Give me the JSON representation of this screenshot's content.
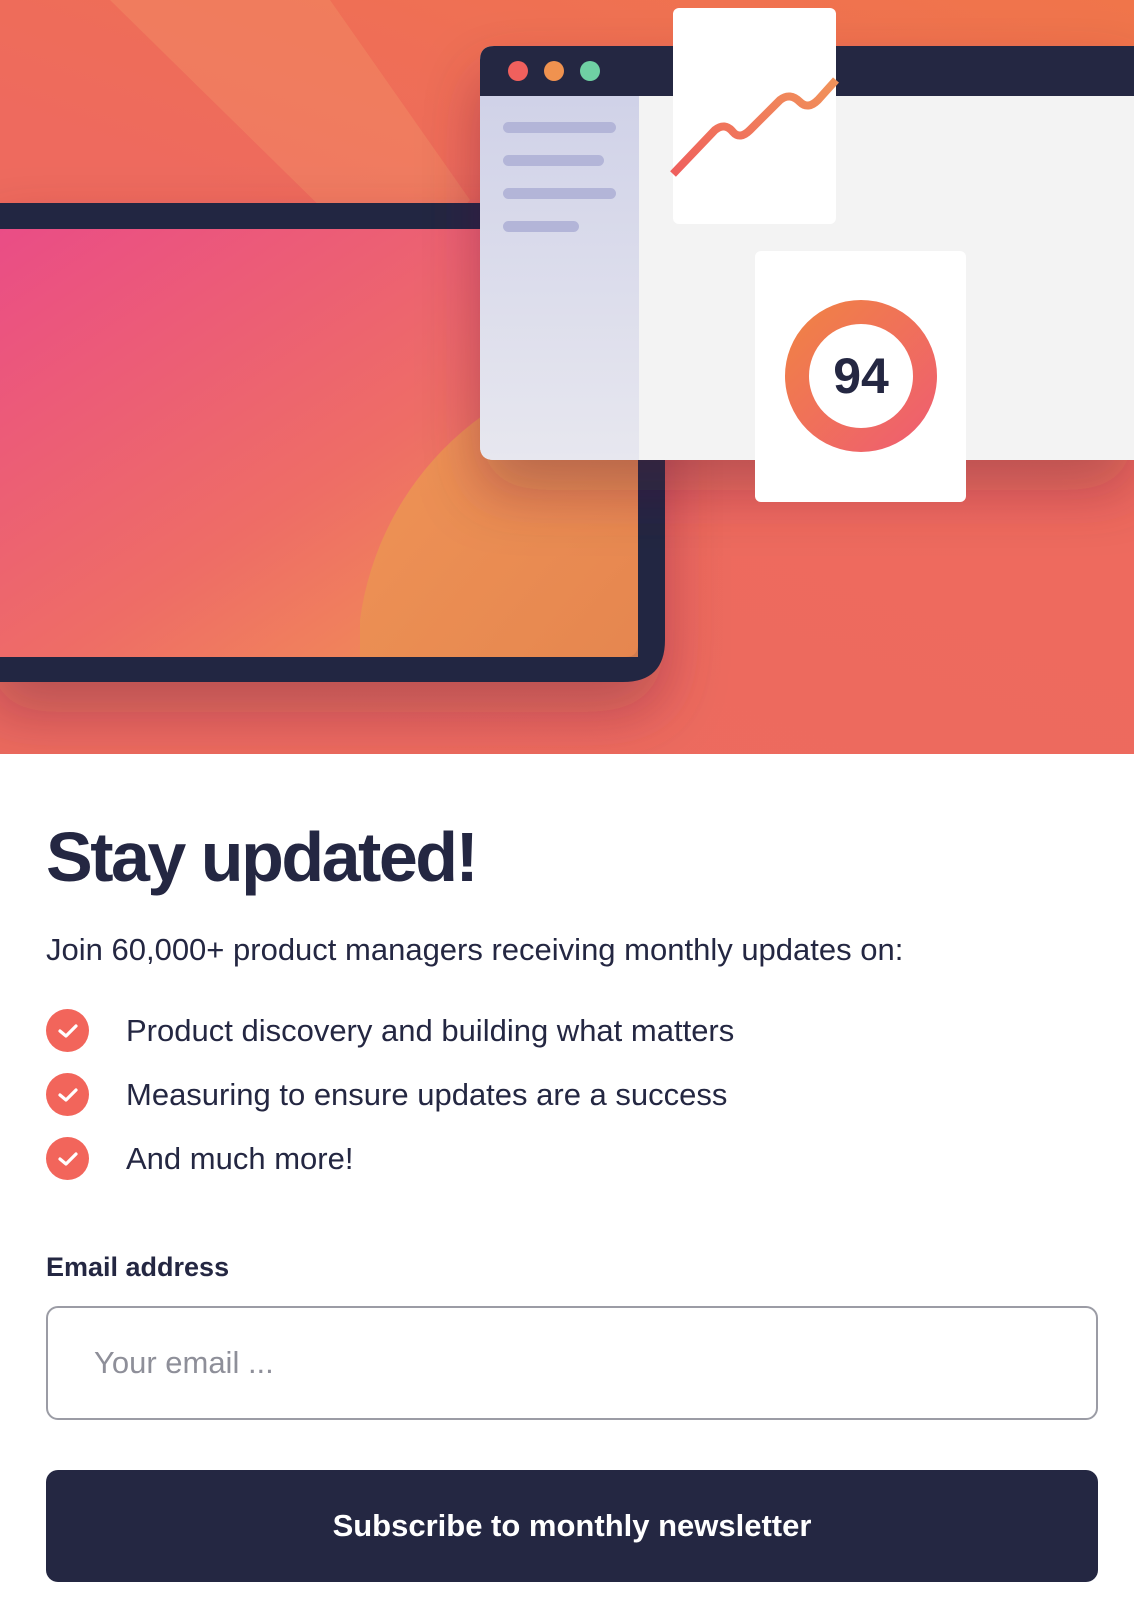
{
  "hero": {
    "score_value": "94",
    "colors": {
      "accent": "#f2655b",
      "dark": "#242742",
      "dot_red": "#f0605d",
      "dot_orange": "#f0924f",
      "dot_green": "#6fd0a3"
    }
  },
  "main": {
    "title": "Stay updated!",
    "intro": "Join 60,000+ product managers receiving monthly updates on:",
    "benefits": [
      {
        "text": "Product discovery and building what matters",
        "icon": "check-icon"
      },
      {
        "text": "Measuring to ensure updates are a success",
        "icon": "check-icon"
      },
      {
        "text": "And much more!",
        "icon": "check-icon"
      }
    ]
  },
  "form": {
    "email_label": "Email address",
    "email_value": "",
    "email_placeholder": "Your email ...",
    "submit_label": "Subscribe to monthly newsletter"
  }
}
